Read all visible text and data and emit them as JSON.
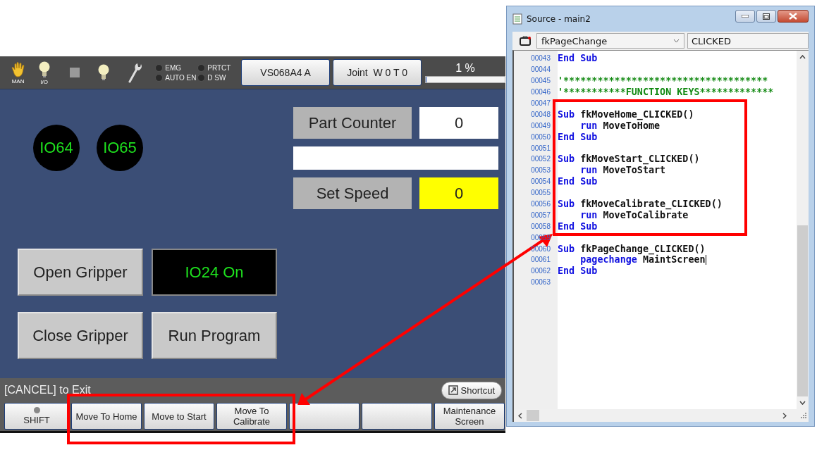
{
  "pendant": {
    "status_bar": {
      "mode_icons": [
        {
          "kind": "hand",
          "label": "MAN"
        },
        {
          "kind": "bulb",
          "label": "I/O"
        }
      ],
      "tool_icons": [
        {
          "kind": "square"
        },
        {
          "kind": "bulb"
        },
        {
          "kind": "wrench"
        }
      ],
      "lamps": [
        {
          "label": "EMG",
          "on": false
        },
        {
          "label": "PRTCT",
          "on": false
        },
        {
          "label": "AUTO EN",
          "on": false
        },
        {
          "label": "D SW",
          "on": false
        }
      ],
      "robot_button": "VS068A4 A",
      "mode_button": "Joint  W 0 T 0",
      "speed": {
        "reading": "1 %",
        "level": 0.01
      }
    },
    "screen": {
      "io_lamps": [
        {
          "label": "IO64"
        },
        {
          "label": "IO65"
        }
      ],
      "fields": [
        {
          "kind": "labeled",
          "label": "Part Counter",
          "value": "0",
          "highlight": false
        },
        {
          "kind": "blank"
        },
        {
          "kind": "labeled",
          "label": "Set Speed",
          "value": "0",
          "highlight": true
        }
      ],
      "buttons": [
        {
          "kind": "button",
          "label": "Open Gripper"
        },
        {
          "kind": "indicator",
          "label": "IO24 On"
        },
        {
          "kind": "button",
          "label": "Close Gripper"
        },
        {
          "kind": "button",
          "label": "Run Program"
        }
      ]
    },
    "hint": "[CANCEL] to Exit",
    "shortcut": "Shortcut",
    "function_keys": [
      {
        "kind": "shift",
        "label": "SHIFT"
      },
      {
        "kind": "key",
        "label": "Move To Home"
      },
      {
        "kind": "key",
        "label": "Move to Start"
      },
      {
        "kind": "key",
        "label": "Move To Calibrate"
      },
      {
        "kind": "blank"
      },
      {
        "kind": "blank"
      },
      {
        "kind": "key",
        "label": "Maintenance Screen"
      }
    ]
  },
  "editor": {
    "title": "Source - main2",
    "object": "fkPageChange",
    "event": "CLICKED",
    "lines": [
      {
        "number": "00043",
        "segments": [
          {
            "kind": "keyword",
            "text": "End Sub"
          }
        ]
      },
      {
        "number": "00044"
      },
      {
        "number": "00045",
        "segments": [
          {
            "kind": "comment",
            "text": "'************************************"
          }
        ]
      },
      {
        "number": "00046",
        "segments": [
          {
            "kind": "comment",
            "text": "'***********FUNCTION KEYS*************"
          }
        ]
      },
      {
        "number": "00047"
      },
      {
        "number": "00048",
        "segments": [
          {
            "kind": "keyword",
            "text": "Sub "
          },
          {
            "kind": "plain",
            "text": "fkMoveHome_CLICKED()"
          }
        ]
      },
      {
        "number": "00049",
        "segments": [
          {
            "kind": "keyword",
            "text": "    run "
          },
          {
            "kind": "plain",
            "text": "MoveToHome"
          }
        ]
      },
      {
        "number": "00050",
        "segments": [
          {
            "kind": "keyword",
            "text": "End Sub"
          }
        ]
      },
      {
        "number": "00051"
      },
      {
        "number": "00052",
        "segments": [
          {
            "kind": "keyword",
            "text": "Sub "
          },
          {
            "kind": "plain",
            "text": "fkMoveStart_CLICKED()"
          }
        ]
      },
      {
        "number": "00053",
        "segments": [
          {
            "kind": "keyword",
            "text": "    run "
          },
          {
            "kind": "plain",
            "text": "MoveToStart"
          }
        ]
      },
      {
        "number": "00054",
        "segments": [
          {
            "kind": "keyword",
            "text": "End Sub"
          }
        ]
      },
      {
        "number": "00055"
      },
      {
        "number": "00056",
        "segments": [
          {
            "kind": "keyword",
            "text": "Sub "
          },
          {
            "kind": "plain",
            "text": "fkMoveCalibrate_CLICKED()"
          }
        ]
      },
      {
        "number": "00057",
        "segments": [
          {
            "kind": "keyword",
            "text": "    run "
          },
          {
            "kind": "plain",
            "text": "MoveToCalibrate"
          }
        ]
      },
      {
        "number": "00058",
        "segments": [
          {
            "kind": "keyword",
            "text": "End Sub"
          }
        ]
      },
      {
        "number": "00059"
      },
      {
        "number": "00060",
        "segments": [
          {
            "kind": "keyword",
            "text": "Sub "
          },
          {
            "kind": "plain",
            "text": "fkPageChange_CLICKED()"
          }
        ]
      },
      {
        "number": "00061",
        "caret": true,
        "segments": [
          {
            "kind": "keyword",
            "text": "    pagechange "
          },
          {
            "kind": "plain",
            "text": "MaintScreen"
          }
        ]
      },
      {
        "number": "00062",
        "segments": [
          {
            "kind": "keyword",
            "text": "End Sub"
          }
        ]
      },
      {
        "number": "00063"
      }
    ]
  }
}
